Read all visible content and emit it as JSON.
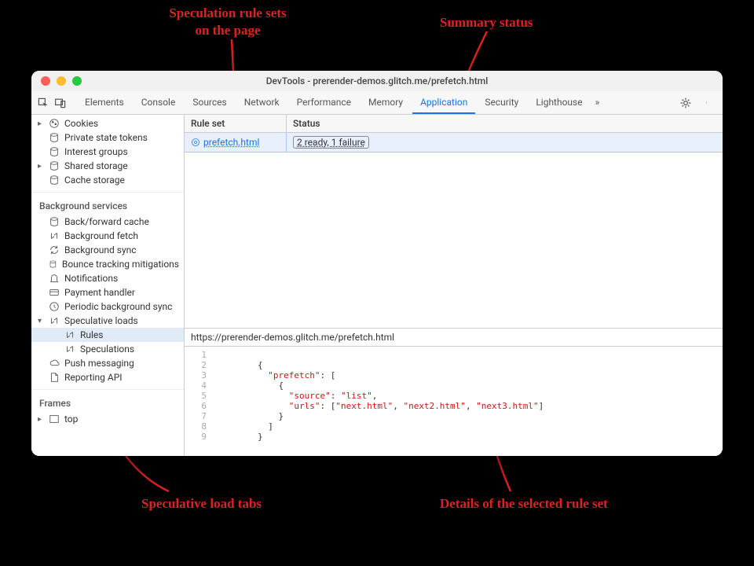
{
  "annotations": {
    "rulesets": "Speculation rule sets\non the page",
    "summary": "Summary status",
    "tabs": "Speculative load tabs",
    "details": "Details of the selected rule set"
  },
  "window": {
    "title": "DevTools - prerender-demos.glitch.me/prefetch.html"
  },
  "tabs": {
    "items": [
      "Elements",
      "Console",
      "Sources",
      "Network",
      "Performance",
      "Memory",
      "Application",
      "Security",
      "Lighthouse"
    ],
    "more": "»"
  },
  "sidebar": {
    "cookies": "Cookies",
    "pst": "Private state tokens",
    "ig": "Interest groups",
    "ss": "Shared storage",
    "cs": "Cache storage",
    "bg_label": "Background services",
    "bfc": "Back/forward cache",
    "bf": "Background fetch",
    "bs": "Background sync",
    "btm": "Bounce tracking mitigations",
    "notif": "Notifications",
    "ph": "Payment handler",
    "pbs": "Periodic background sync",
    "sl": "Speculative loads",
    "rules": "Rules",
    "spec": "Speculations",
    "pm": "Push messaging",
    "rapi": "Reporting API",
    "frames_label": "Frames",
    "top": "top"
  },
  "grid": {
    "col_rule": "Rule set",
    "col_status": "Status",
    "row": {
      "rule": "prefetch.html",
      "status": "2 ready, 1 failure"
    }
  },
  "url": "https://prerender-demos.glitch.me/prefetch.html",
  "code": {
    "lines": [
      "",
      "{",
      "  \"prefetch\": [",
      "    {",
      "      \"source\": \"list\",",
      "      \"urls\": [\"next.html\", \"next2.html\", \"next3.html\"]",
      "    }",
      "  ]",
      "}"
    ]
  }
}
